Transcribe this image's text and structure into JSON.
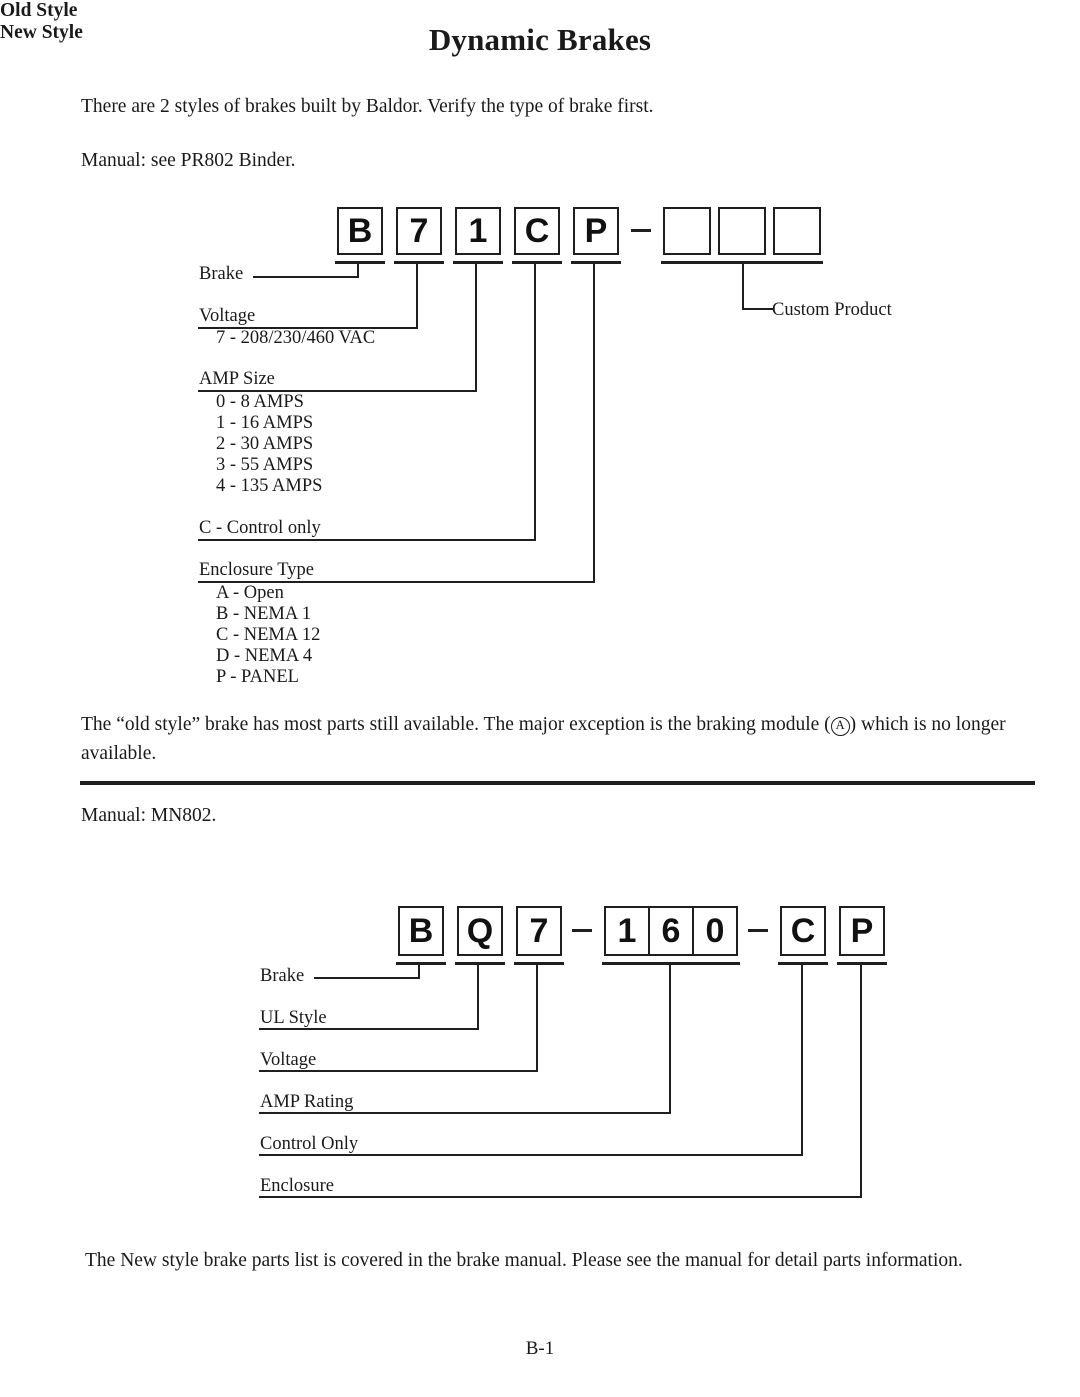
{
  "document": {
    "title": "Dynamic Brakes",
    "page_number": "B-1"
  },
  "intro_text": "There are 2 styles of brakes built by Baldor. Verify the type of brake first.",
  "old_style": {
    "manual_line": "Manual: see PR802 Binder.",
    "heading": "Old Style",
    "model_code": [
      "B",
      "7",
      "1",
      "C",
      "P"
    ],
    "separator": "–",
    "blank_boxes": 3,
    "labels": {
      "brake": "Brake",
      "voltage": "Voltage",
      "amp_size": "AMP Size",
      "control_only": "C - Control only",
      "enclosure_type": "Enclosure Type",
      "custom_product": "Custom Product"
    },
    "voltage_options": [
      "7 - 208/230/460 VAC"
    ],
    "amp_size_options": [
      "0 - 8 AMPS",
      "1 - 16 AMPS",
      "2 - 30 AMPS",
      "3 - 55 AMPS",
      "4 - 135 AMPS"
    ],
    "enclosure_options": [
      "A - Open",
      "B - NEMA 1",
      "C - NEMA 12",
      "D - NEMA 4",
      "P - PANEL"
    ],
    "note_part1": "The “old style” brake has most parts still available. The major exception is the braking module (",
    "note_symbol": "A",
    "note_part2": ") which is no longer available."
  },
  "new_style": {
    "manual_line": "Manual: MN802.",
    "heading": "New Style",
    "model_code": [
      "B",
      "Q",
      "7",
      "1",
      "6",
      "0",
      "C",
      "P"
    ],
    "separator": "–",
    "labels": {
      "brake": "Brake",
      "ul_style": "UL Style",
      "voltage": "Voltage",
      "amp_rating": "AMP Rating",
      "control_only": "Control Only",
      "enclosure": "Enclosure"
    },
    "note": "The New style brake parts list is covered in the brake manual. Please see the manual for detail parts information."
  },
  "colors": {
    "ink": "#1a1a1a",
    "rule": "#1f1f1f",
    "page": "#ffffff"
  }
}
